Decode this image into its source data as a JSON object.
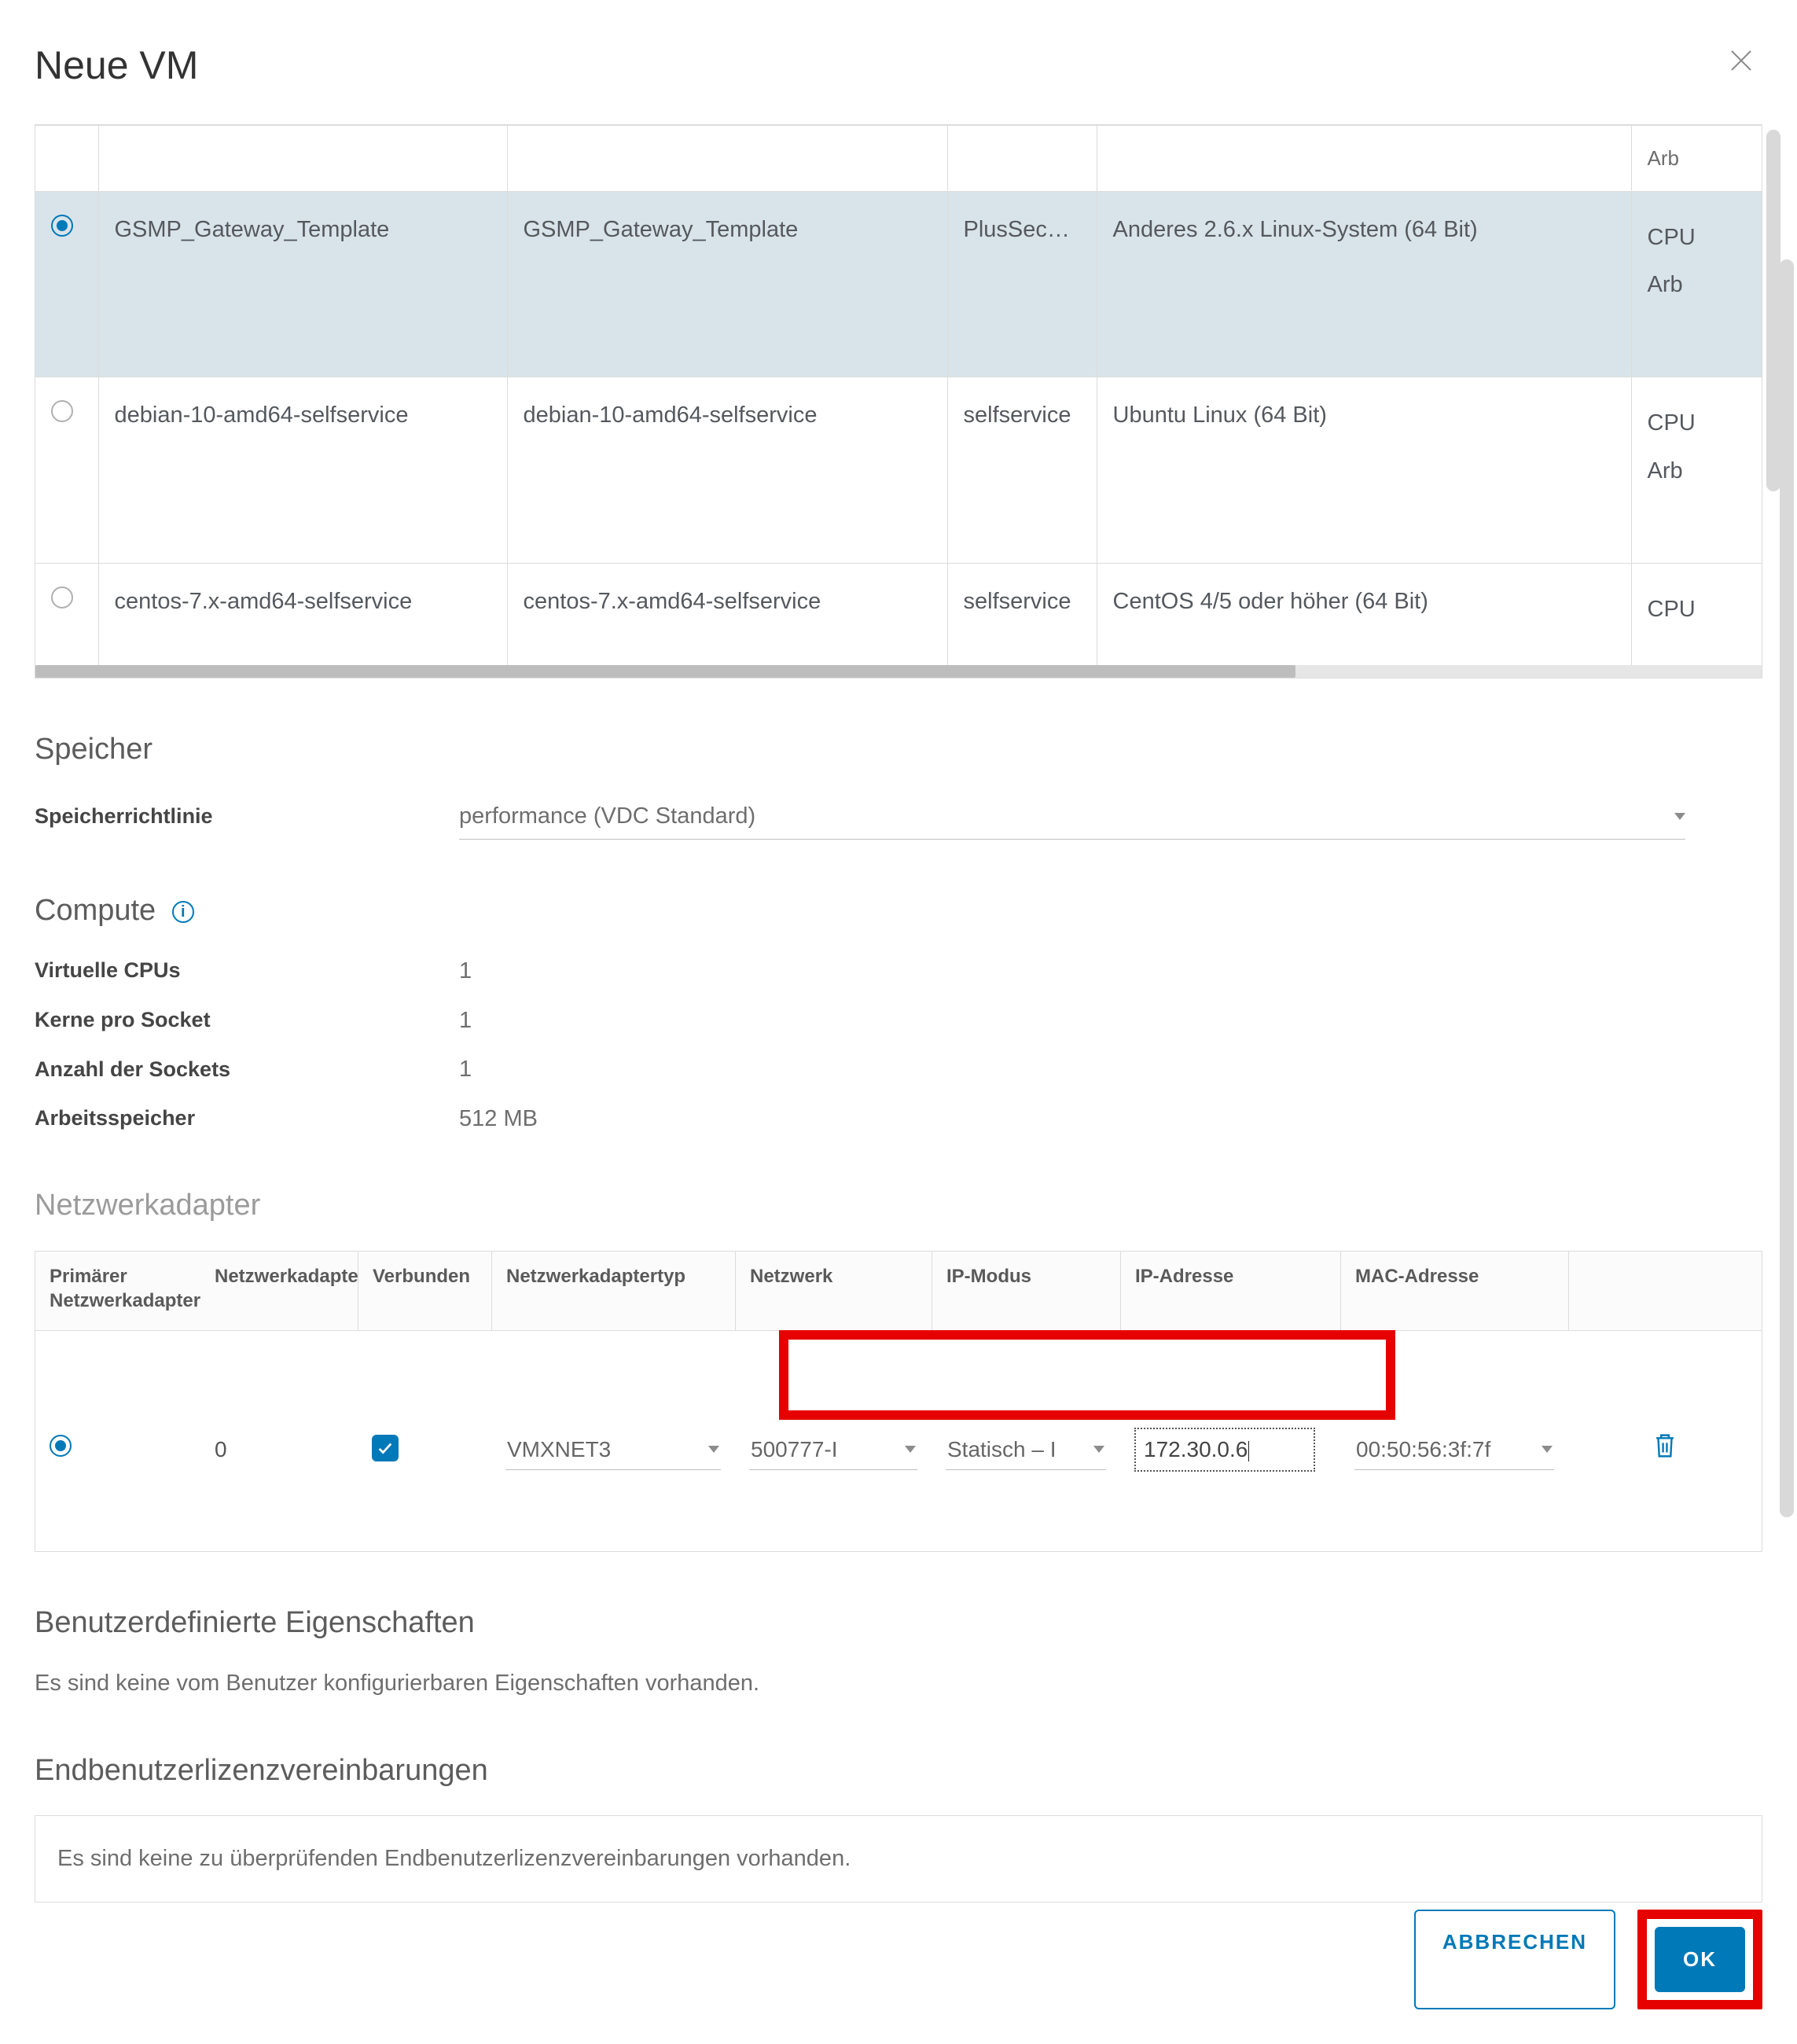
{
  "dialog": {
    "title": "Neue VM"
  },
  "templates": {
    "overflowCol": "Arb",
    "rows": [
      {
        "selected": true,
        "name": "GSMP_Gateway_Template",
        "catalog": "GSMP_Gateway_Template",
        "owner": "PlusSecuri...",
        "os": "Anderes 2.6.x Linux-System (64 Bit)",
        "extra": [
          "CPU",
          "Arb"
        ]
      },
      {
        "selected": false,
        "name": "debian-10-amd64-selfservice",
        "catalog": "debian-10-amd64-selfservice",
        "owner": "selfservice",
        "os": "Ubuntu Linux (64 Bit)",
        "extra": [
          "CPU",
          "Arb"
        ]
      },
      {
        "selected": false,
        "name": "centos-7.x-amd64-selfservice",
        "catalog": "centos-7.x-amd64-selfservice",
        "owner": "selfservice",
        "os": "CentOS 4/5 oder höher (64 Bit)",
        "extra": [
          "CPU"
        ]
      }
    ]
  },
  "storage": {
    "heading": "Speicher",
    "policyLabel": "Speicherrichtlinie",
    "policyValue": "performance (VDC Standard)"
  },
  "compute": {
    "heading": "Compute",
    "vcpusLabel": "Virtuelle CPUs",
    "vcpus": "1",
    "coresLabel": "Kerne pro Socket",
    "cores": "1",
    "socketsLabel": "Anzahl der Sockets",
    "sockets": "1",
    "memLabel": "Arbeitsspeicher",
    "mem": "512 MB"
  },
  "nic": {
    "heading": "Netzwerkadapter",
    "cols": {
      "primary": "Primärer Netzwerkadapter",
      "index": "Netzwerkadapter",
      "connected": "Verbunden",
      "type": "Netzwerkadaptertyp",
      "network": "Netzwerk",
      "mode": "IP-Modus",
      "ip": "IP-Adresse",
      "mac": "MAC-Adresse"
    },
    "row": {
      "index": "0",
      "type": "VMXNET3",
      "network": "500777-I",
      "mode": "Statisch – I",
      "ip": "172.30.0.6",
      "mac": "00:50:56:3f:7f"
    }
  },
  "custom": {
    "heading": "Benutzerdefinierte Eigenschaften",
    "text": "Es sind keine vom Benutzer konfigurierbaren Eigenschaften vorhanden."
  },
  "eula": {
    "heading": "Endbenutzerlizenzvereinbarungen",
    "text": "Es sind keine zu überprüfenden Endbenutzerlizenzvereinbarungen vorhanden."
  },
  "footer": {
    "cancel": "ABBRECHEN",
    "ok": "OK"
  }
}
